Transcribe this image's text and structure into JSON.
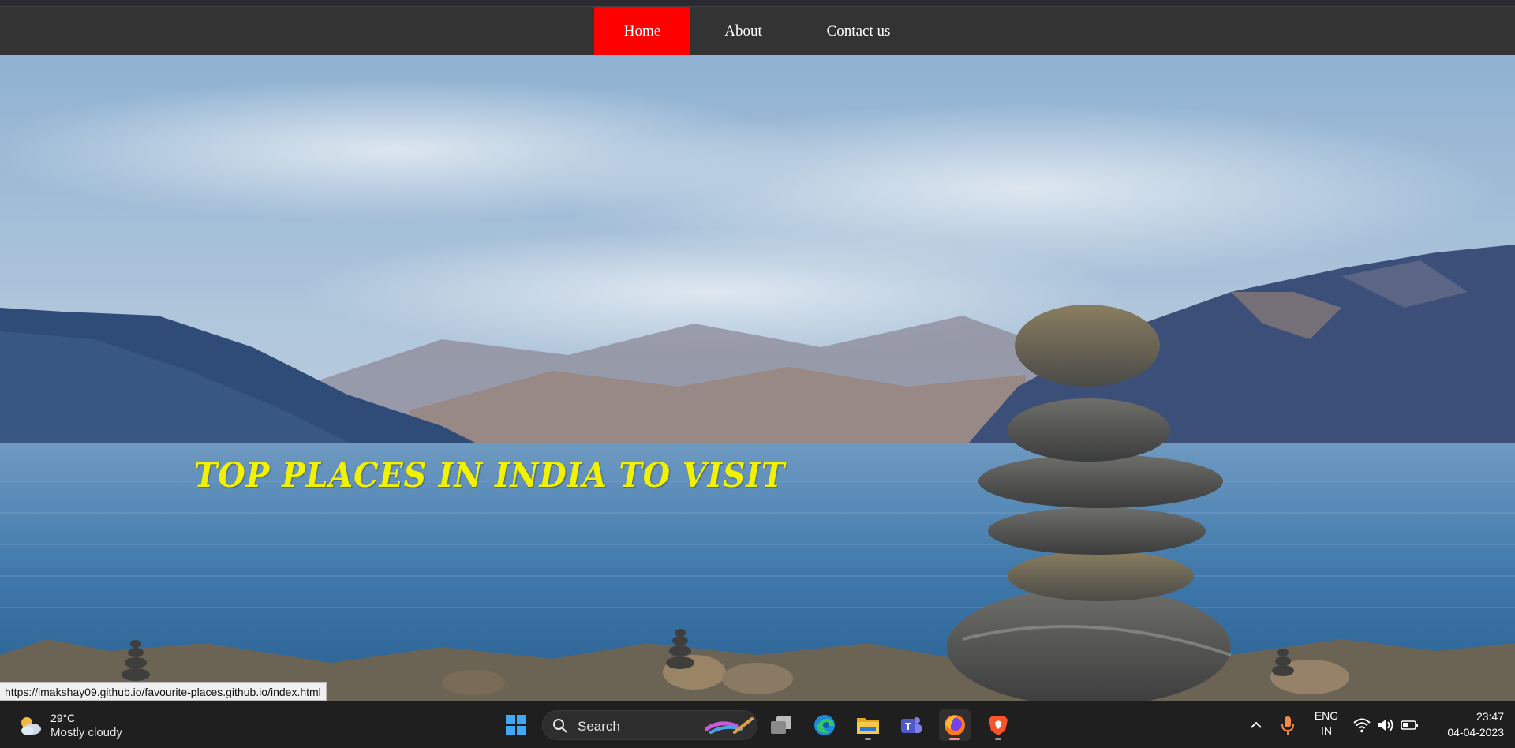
{
  "nav": {
    "items": [
      {
        "label": "Home",
        "active": true
      },
      {
        "label": "About",
        "active": false
      },
      {
        "label": "Contact us",
        "active": false
      }
    ],
    "active_color": "#ff0000",
    "background": "#333333"
  },
  "hero": {
    "title": "TOP PLACES IN INDIA TO VISIT",
    "title_color": "#f2f200"
  },
  "status_bar": {
    "url": "https://imakshay09.github.io/favourite-places.github.io/index.html"
  },
  "taskbar": {
    "weather": {
      "temp": "29°C",
      "desc": "Mostly cloudy",
      "icon": "partly-cloudy-icon"
    },
    "search_label": "Search",
    "apps": [
      {
        "name": "windows-start-icon"
      },
      {
        "name": "task-view-icon"
      },
      {
        "name": "edge-icon"
      },
      {
        "name": "file-explorer-icon"
      },
      {
        "name": "teams-icon"
      },
      {
        "name": "firefox-icon"
      },
      {
        "name": "brave-icon"
      }
    ],
    "language": {
      "line1": "ENG",
      "line2": "IN"
    },
    "clock": {
      "time": "23:47",
      "date": "04-04-2023"
    }
  }
}
